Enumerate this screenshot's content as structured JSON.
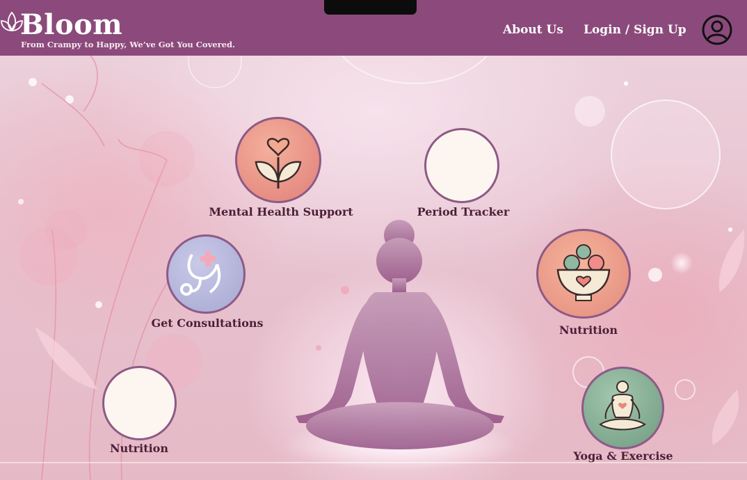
{
  "header": {
    "brand": "Bloom",
    "tagline": "From Crampy to Happy, We’ve Got You Covered.",
    "nav": {
      "about": "About Us",
      "login": "Login / Sign Up"
    },
    "logo_icon": "lotus-icon",
    "profile_icon": "user-profile-icon"
  },
  "features": {
    "mental_health": {
      "label": "Mental Health Support",
      "icon": "heart-sprout-icon"
    },
    "period_tracker": {
      "label": "Period Tracker"
    },
    "consultations": {
      "label": "Get Consultations",
      "icon": "stethoscope-icon"
    },
    "nutrition_right": {
      "label": "Nutrition",
      "icon": "fruit-bowl-icon"
    },
    "nutrition_left": {
      "label": "Nutrition"
    },
    "yoga": {
      "label": "Yoga & Exercise",
      "icon": "meditation-icon"
    }
  },
  "colors": {
    "header": "#8b4a7b",
    "label": "#4b1f35",
    "circle_border": "#8d5a86",
    "placeholder_fill": "#fdf5ef"
  }
}
